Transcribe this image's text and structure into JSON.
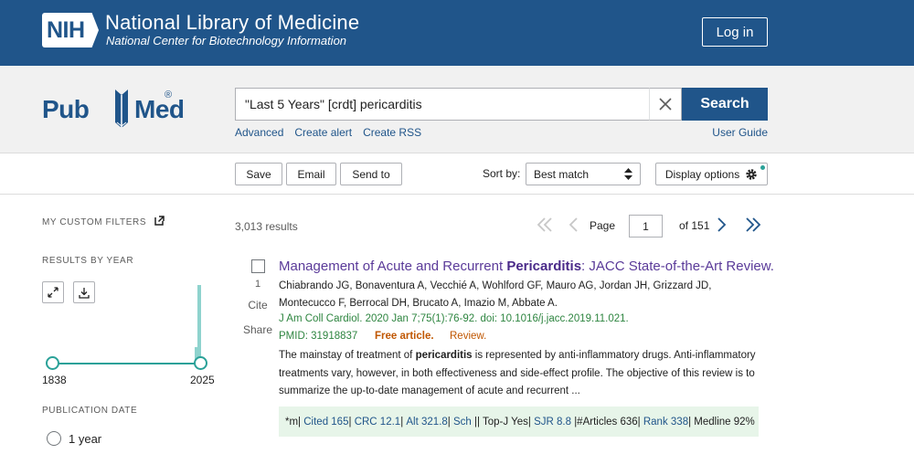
{
  "banner": {
    "logo_text": "NIH",
    "title": "National Library of Medicine",
    "subtitle": "National Center for Biotechnology Information",
    "login_label": "Log in"
  },
  "pubmed_logo": {
    "pub": "Pub",
    "med": "Med",
    "reg": "®"
  },
  "search": {
    "query": "\"Last 5 Years\" [crdt] pericarditis",
    "button_label": "Search",
    "links": [
      "Advanced",
      "Create alert",
      "Create RSS"
    ],
    "user_guide": "User Guide"
  },
  "actions": {
    "save": "Save",
    "email": "Email",
    "send_to": "Send to",
    "sort_label": "Sort by:",
    "sort_value": "Best match",
    "display_options": "Display options"
  },
  "sidebar": {
    "my_custom_filters": "MY CUSTOM FILTERS",
    "results_by_year": "RESULTS BY YEAR",
    "year_start": "1838",
    "year_end": "2025",
    "publication_date": "PUBLICATION DATE",
    "date_option_1": "1 year"
  },
  "results": {
    "count": "3,013 results",
    "page_label": "Page",
    "page_value": "1",
    "page_total": "of 151"
  },
  "article": {
    "number": "1",
    "cite": "Cite",
    "share": "Share",
    "title_pre": "Management of Acute and Recurrent ",
    "title_bold": "Pericarditis",
    "title_post": ": JACC State-of-the-Art Review.",
    "authors": "Chiabrando JG, Bonaventura A, Vecchié A, Wohlford GF, Mauro AG, Jordan JH, Grizzard JD, Montecucco F, Berrocal DH, Brucato A, Imazio M, Abbate A.",
    "journal": "J Am Coll Cardiol. 2020 Jan 7;75(1):76-92. doi: 10.1016/j.jacc.2019.11.021.",
    "pmid": "PMID: 31918837",
    "free": "Free article.",
    "review": "Review.",
    "abstract_pre": "The mainstay of treatment of ",
    "abstract_bold": "pericarditis",
    "abstract_post": " is represented by anti-inflammatory drugs. Anti-inflammatory treatments vary, however, in both effectiveness and side-effect profile. The objective of this review is to summarize the up-to-date management of acute and recurrent ...",
    "metrics": {
      "m": "*m|",
      "cited": "Cited 165",
      "sep1": "|",
      "crc": "CRC 12.1",
      "sep2": "|",
      "alt": "Alt 321.8",
      "sep3": "|",
      "sch": "Sch",
      "topj": "|| Top-J Yes|",
      "sjr": "SJR 8.8",
      "articles": "|#Articles 636|",
      "rank": "Rank 338",
      "medline": "| Medline 92%"
    }
  },
  "colors": {
    "brand": "#20558a",
    "accent": "#2aa198",
    "visited": "#5a3a99"
  }
}
